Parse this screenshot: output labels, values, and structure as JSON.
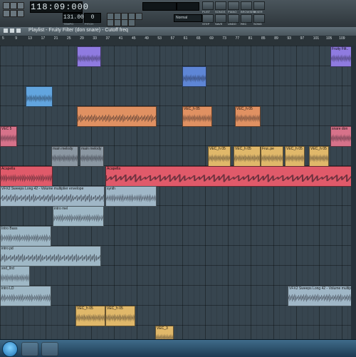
{
  "toolbar": {
    "time": "118:09:000",
    "tempo_value": "131.000",
    "pitch_value": "0",
    "tempo_label": "TEMPO",
    "pitch_label": "PITCH",
    "mode_value": "Normal",
    "buttons": [
      {
        "label": "PLIST"
      },
      {
        "label": "SONGS"
      },
      {
        "label": "PIANO"
      },
      {
        "label": "BROWSER"
      },
      {
        "label": "MIXER"
      },
      {
        "label": "STEP"
      },
      {
        "label": "SAVE"
      },
      {
        "label": "UNDO"
      },
      {
        "label": "REC"
      },
      {
        "label": "SONG"
      }
    ]
  },
  "titlebar": {
    "text": "Playlist - Fruity Filter (don snare) - Cutoff freq"
  },
  "ruler": {
    "ticks": [
      "5",
      "9",
      "13",
      "17",
      "21",
      "25",
      "29",
      "33",
      "37",
      "41",
      "45",
      "49",
      "53",
      "57",
      "61",
      "65",
      "69",
      "73",
      "77",
      "81",
      "85",
      "89",
      "93",
      "97",
      "101",
      "105",
      "109"
    ]
  },
  "clips": [
    {
      "label": "",
      "color": "#8f7be0",
      "row": 0
    },
    {
      "label": "Fruity Filt..",
      "color": "#8f7be0",
      "row": 0
    },
    {
      "label": "",
      "color": "#5e86d6",
      "row": 1
    },
    {
      "label": "",
      "color": "#62a5df",
      "row": 2
    },
    {
      "label": "",
      "color": "#e09162",
      "row": 3
    },
    {
      "label": "VEC_h 05",
      "color": "#e09162",
      "row": 3
    },
    {
      "label": "VEC_h 05",
      "color": "#e09162",
      "row": 3
    },
    {
      "label": "VEC 5",
      "color": "#d7728a",
      "row": 4
    },
    {
      "label": "snare don",
      "color": "#d7728a",
      "row": 4
    },
    {
      "label": "main melody",
      "color": "#8b97a2",
      "row": 5
    },
    {
      "label": "main melody",
      "color": "#8b97a2",
      "row": 5
    },
    {
      "label": "VEC_h 05",
      "color": "#e0b86a",
      "row": 5
    },
    {
      "label": "Frui..pe",
      "color": "#e0b86a",
      "row": 5
    },
    {
      "label": "VEC_h 05",
      "color": "#e0b86a",
      "row": 5
    },
    {
      "label": "VEC_h 05",
      "color": "#e0b86a",
      "row": 5
    },
    {
      "label": "VEC_h 05",
      "color": "#e0b86a",
      "row": 5
    },
    {
      "label": "Acapella",
      "color": "#e05a6a",
      "row": 6
    },
    {
      "label": "Acapella",
      "color": "#e05a6a",
      "row": 6
    },
    {
      "label": "VFX2 Sweeps Long 42 - Volume multiplier envelope",
      "color": "#a0b7c7",
      "row": 7
    },
    {
      "label": "synth",
      "color": "#a0b7c7",
      "row": 7
    },
    {
      "label": "intro mel",
      "color": "#9fb8c6",
      "row": 8
    },
    {
      "label": "Intro Bass",
      "color": "#9fb8c6",
      "row": 9
    },
    {
      "label": "intro pd",
      "color": "#9fb8c6",
      "row": 10
    },
    {
      "label": "snd_lIrd",
      "color": "#9fb8c6",
      "row": 11
    },
    {
      "label": "intro LD",
      "color": "#9fb8c6",
      "row": 12
    },
    {
      "label": "VFX2 Sweeps Long 42 - Volume multipli..",
      "color": "#a0b7c7",
      "row": 12
    },
    {
      "label": "VEC_h 05",
      "color": "#e0b86a",
      "row": 13
    },
    {
      "label": "VEC_h 05",
      "color": "#e0b86a",
      "row": 13
    },
    {
      "label": "VEC_3",
      "color": "#e0b86a",
      "row": 14
    }
  ]
}
